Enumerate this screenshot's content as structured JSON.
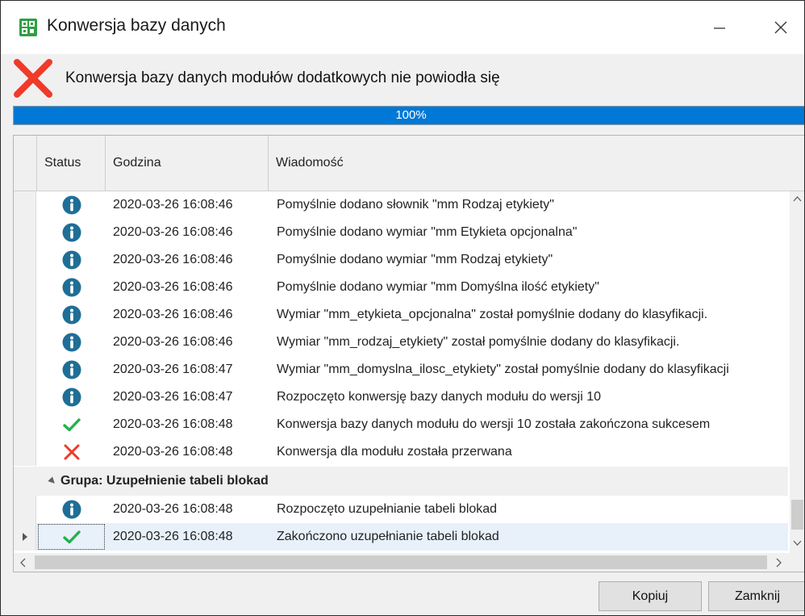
{
  "window": {
    "title": "Konwersja bazy danych",
    "minimize_glyph": "—",
    "close_glyph": "✕"
  },
  "header": {
    "message": "Konwersja bazy danych modułów dodatkowych nie powiodła się",
    "icon": "error-x-icon"
  },
  "progress": {
    "value": 100,
    "label": "100%"
  },
  "grid": {
    "columns": [
      "Status",
      "Godzina",
      "Wiadomość"
    ],
    "rows": [
      {
        "status": "info",
        "time": "2020-03-26 16:08:46",
        "message": "Pomyślnie dodano słownik  \"mm Rodzaj etykiety\""
      },
      {
        "status": "info",
        "time": "2020-03-26 16:08:46",
        "message": "Pomyślnie dodano wymiar  \"mm Etykieta opcjonalna\""
      },
      {
        "status": "info",
        "time": "2020-03-26 16:08:46",
        "message": "Pomyślnie dodano wymiar  \"mm Rodzaj etykiety\""
      },
      {
        "status": "info",
        "time": "2020-03-26 16:08:46",
        "message": "Pomyślnie dodano wymiar  \"mm Domyślna ilość etykiety\""
      },
      {
        "status": "info",
        "time": "2020-03-26 16:08:46",
        "message": "Wymiar \"mm_etykieta_opcjonalna\" został pomyślnie dodany do klasyfikacji."
      },
      {
        "status": "info",
        "time": "2020-03-26 16:08:46",
        "message": "Wymiar \"mm_rodzaj_etykiety\" został pomyślnie dodany do klasyfikacji."
      },
      {
        "status": "info",
        "time": "2020-03-26 16:08:47",
        "message": "Wymiar \"mm_domyslna_ilosc_etykiety\" został pomyślnie dodany do klasyfikacji"
      },
      {
        "status": "info",
        "time": "2020-03-26 16:08:47",
        "message": "Rozpoczęto konwersję bazy danych modułu do wersji 10"
      },
      {
        "status": "success",
        "time": "2020-03-26 16:08:48",
        "message": "Konwersja bazy danych modułu do wersji 10 została zakończona sukcesem"
      },
      {
        "status": "error",
        "time": "2020-03-26 16:08:48",
        "message": "Konwersja dla modułu została przerwana"
      }
    ],
    "group": {
      "label": "Grupa: Uzupełnienie tabeli blokad",
      "rows": [
        {
          "status": "info",
          "time": "2020-03-26 16:08:48",
          "message": "Rozpoczęto uzupełnianie tabeli blokad"
        },
        {
          "status": "success",
          "time": "2020-03-26 16:08:48",
          "message": "Zakończono uzupełnianie tabeli blokad",
          "selected": true
        }
      ]
    }
  },
  "footer": {
    "copy_label": "Kopiuj",
    "close_label": "Zamknij"
  },
  "colors": {
    "info": "#1f6e96",
    "success": "#22b14c",
    "error": "#f03a2a",
    "progress": "#0078d7",
    "app_icon": "#2ea043"
  }
}
